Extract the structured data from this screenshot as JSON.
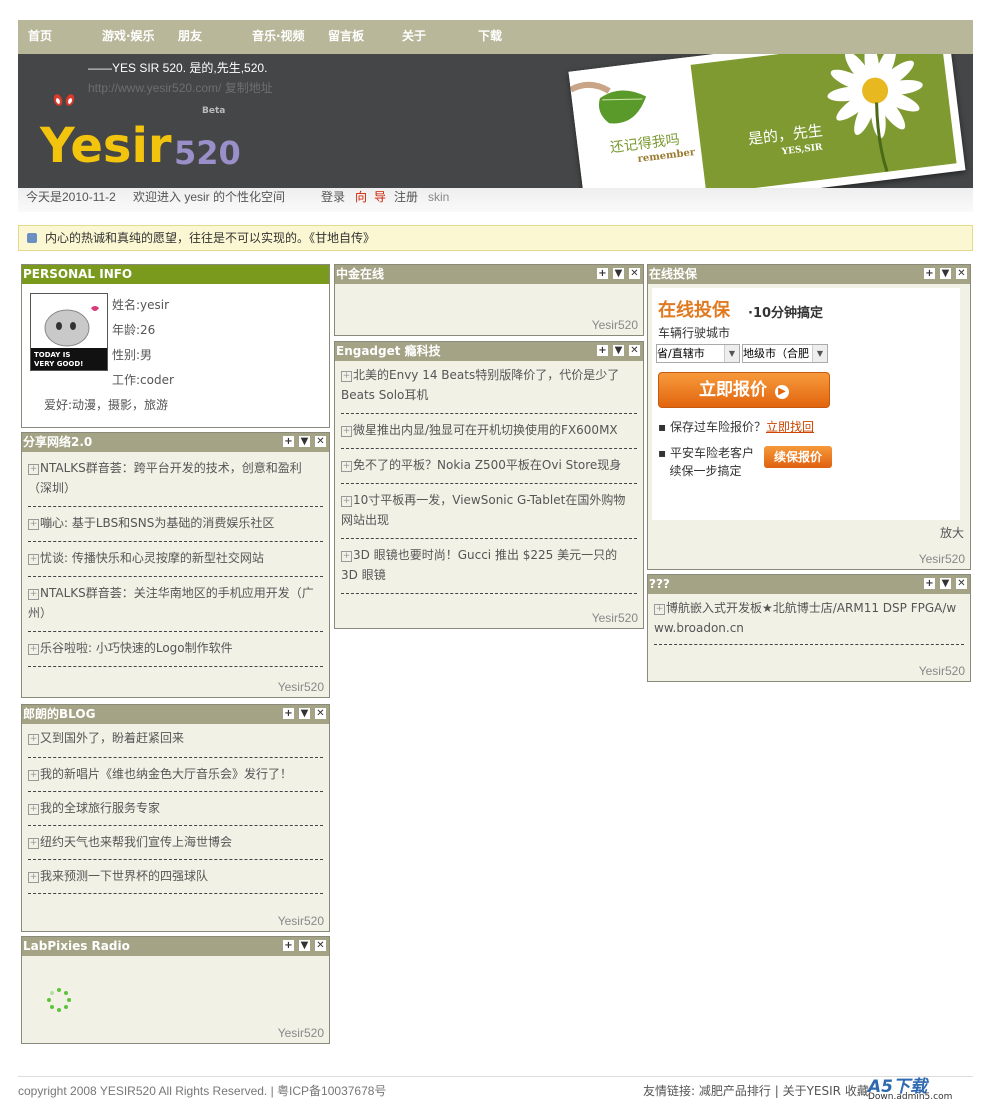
{
  "nav": [
    "首页",
    "游戏·娱乐",
    "朋友",
    "音乐·视频",
    "留言板",
    "关于",
    "下载"
  ],
  "header": {
    "slogan": "——YES SIR 520. 是的,先生,520.",
    "url": "http://www.yesir520.com/",
    "copy_address": "复制地址",
    "logo_text": "Yesir",
    "logo_num": "520",
    "beta": "Beta",
    "banner_left_cn": "还记得我吗",
    "banner_left_en": "remember",
    "banner_right_cn": "是的，先生",
    "banner_right_en": "YES,SIR"
  },
  "welcome": {
    "date_text": "今天是2010-11-2",
    "greeting": "欢迎进入 yesir 的个性化空间",
    "login": "登录",
    "guide1": "向",
    "guide2": "导",
    "register": "注册",
    "skin": "skin"
  },
  "quote": "内心的热诚和真纯的愿望，往往是不可以实现的。《甘地自传》",
  "personal": {
    "title": "PERSONAL INFO",
    "name": "姓名:yesir",
    "age": "年龄:26",
    "gender": "性别:男",
    "work": "工作:coder",
    "hobby": "爱好:动漫，摄影，旅游",
    "avatar_text1": "TODAY IS",
    "avatar_text2": "VERY GOOD!"
  },
  "share": {
    "title": "分享网络2.0",
    "items": [
      "NTALKS群音荟：跨平台开发的技术，创意和盈利（深圳）",
      "嘣心: 基于LBS和SNS为基础的消费娱乐社区",
      "忧谈: 传播快乐和心灵按摩的新型社交网站",
      "NTALKS群音荟：关注华南地区的手机应用开发（广州）",
      "乐谷啦啦: 小巧快速的Logo制作软件"
    ],
    "footer": "Yesir520"
  },
  "blog": {
    "title": "郎朗的BLOG",
    "items": [
      "又到国外了，盼着赶紧回来",
      "我的新唱片《维也纳金色大厅音乐会》发行了！",
      "我的全球旅行服务专家",
      "纽约天气也来帮我们宣传上海世博会",
      "我来预测一下世界杯的四强球队"
    ],
    "footer": "Yesir520"
  },
  "radio": {
    "title": "LabPixies Radio",
    "footer": "Yesir520"
  },
  "zhongjin": {
    "title": "中金在线",
    "footer": "Yesir520"
  },
  "engadget": {
    "title": "Engadget 瘾科技",
    "items": [
      "北美的Envy 14 Beats特别版降价了，代价是少了Beats Solo耳机",
      "微星推出内显/独显可在开机切换使用的FX600MX",
      "免不了的平板？Nokia Z500平板在Ovi Store现身",
      "10寸平板再一发，ViewSonic G-Tablet在国外购物网站出现",
      "3D 眼镜也要时尚！Gucci 推出 $225 美元一只的 3D 眼镜"
    ],
    "footer": "Yesir520"
  },
  "insurance": {
    "title": "在线投保",
    "head": "在线投保",
    "head_sub": "·10分钟搞定",
    "city_label": "车辆行驶城市",
    "province": "省/直辖市",
    "city": "地级市（合肥",
    "quote_btn": "立即报价",
    "bullet1": "保存过车险报价？",
    "bullet1_link": "立即找回",
    "bullet2a": "平安车险老客户",
    "bullet2b": "续保一步搞定",
    "renew_btn": "续保报价",
    "enlarge": "放大",
    "footer": "Yesir520"
  },
  "unknown": {
    "title": "???",
    "item": "博航嵌入式开发板★北航博士店/ARM11 DSP FPGA/www.broadon.cn",
    "footer": "Yesir520"
  },
  "footer": {
    "copyright": "copyright 2008 YESIR520 All Rights Reserved.  |  粤ICP备10037678号",
    "friends_label": "友情链接:",
    "friend1": "减肥产品排行",
    "sep": "|",
    "about": "关于YESIR",
    "fav": "收藏"
  },
  "watermark": {
    "main": "A5下载",
    "sub": "Down.admin5.com"
  },
  "colors": {
    "nav_bg": "#b8b79a",
    "header_bg": "#444647",
    "widget_head": "#a4a386",
    "personal_head": "#7a9a1e",
    "accent_orange": "#e2650e"
  }
}
